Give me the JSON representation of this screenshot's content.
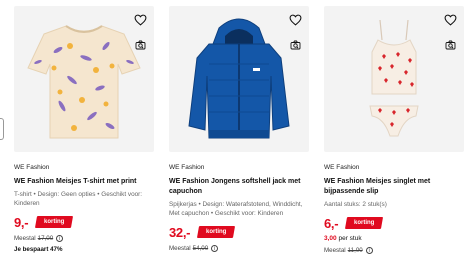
{
  "colors": {
    "accent_red": "#e00a1f",
    "image_bg": "#f3f3f3",
    "text_muted": "#666666"
  },
  "products": [
    {
      "brand": "WE Fashion",
      "title": "WE Fashion Meisjes T-shirt met print",
      "specs": "T-shirt • Design: Geen opties • Geschikt voor: Kinderen",
      "price": "9,-",
      "badge": "korting",
      "was_label": "Meestal",
      "was_price": "17,00",
      "saving": "Je bespaart 47%",
      "icons": [
        "heart-icon",
        "camera-search-icon",
        "info-icon"
      ]
    },
    {
      "brand": "WE Fashion",
      "title": "WE Fashion Jongens softshell jack met capuchon",
      "specs": "Spijkerjas • Design: Waterafstotend, Winddicht, Met capuchon • Geschikt voor: Kinderen",
      "price": "32,-",
      "badge": "korting",
      "was_label": "Meestal",
      "was_price": "54,00",
      "icons": [
        "heart-icon",
        "camera-search-icon",
        "info-icon"
      ]
    },
    {
      "brand": "WE Fashion",
      "title": "WE Fashion Meisjes singlet met bijpassende slip",
      "specs": "Aantal stuks: 2 stuk(s)",
      "price": "6,-",
      "badge": "korting",
      "unit_price": "3,00",
      "unit_suffix": " per stuk",
      "was_label": "Meestal",
      "was_price": "11,00",
      "icons": [
        "heart-icon",
        "camera-search-icon",
        "info-icon"
      ]
    }
  ]
}
